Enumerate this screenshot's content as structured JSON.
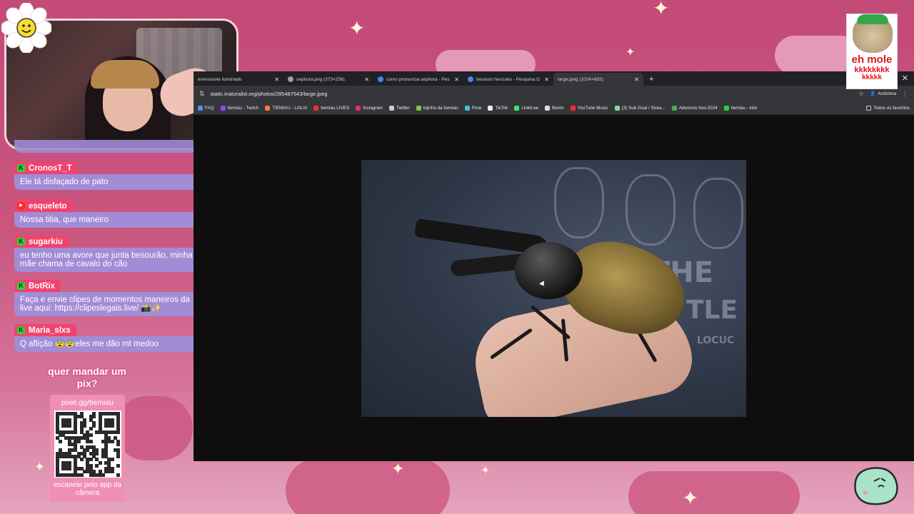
{
  "webcam": {
    "heart_colors": [
      "#ff3fa0",
      "#f7e05a",
      "#48d6c8"
    ]
  },
  "chat": {
    "messages": [
      {
        "platform": "kick",
        "user": "CronosT_T",
        "text": "Ele tá disfaçado de pato"
      },
      {
        "platform": "youtube",
        "user": "esqueleto",
        "text": "Nossa titia, que maneiro"
      },
      {
        "platform": "kick",
        "user": "sugarkiu",
        "text": "eu tenho uma avore que junta besourão, minha mãe chama de cavalo do cão"
      },
      {
        "platform": "kick",
        "user": "BotRix",
        "text": "Faça e envie clipes de momentos maneiros da live aqui: https://clipeslegais.live/ 📸✨"
      },
      {
        "platform": "kick",
        "user": "Maria_slxs",
        "text": "Q aflição 😨😨eles me dão mt medoo"
      }
    ],
    "colors": {
      "user_bg": "#f1426d",
      "bubble_bg": "#a38cd6"
    }
  },
  "pix": {
    "title": "quer mandar um pix?",
    "url": "pixie.gg/tiemiau",
    "scan_text": "escaneie pelo app da câmera"
  },
  "browser": {
    "tabs": [
      {
        "title": "ervescente iluminado",
        "active": false
      },
      {
        "title": "sephora.png (373×258)",
        "active": false
      },
      {
        "title": "como pronuncia sephora - Pes",
        "active": false
      },
      {
        "title": "besouro hercules - Pesquisa G",
        "active": false
      },
      {
        "title": "large.jpeg (1024×683)",
        "active": true
      }
    ],
    "new_tab": "+",
    "close_window": "✕",
    "address": "static.inaturalist.org/photos/285487543/large.jpeg",
    "profile": "Anônima",
    "bookmarks": [
      {
        "label": "FAQ",
        "color": "#4f8ff7"
      },
      {
        "label": "tiemiau - Twitch",
        "color": "#9146ff"
      },
      {
        "label": "TIEMIAU - LOLIA",
        "color": "#ff7a3d"
      },
      {
        "label": "tiemiau LIVES",
        "color": "#ff2a2a"
      },
      {
        "label": "Instagram",
        "color": "#e1306c"
      },
      {
        "label": "Twitter",
        "color": "#cccccc"
      },
      {
        "label": "lojinha da tiemiau",
        "color": "#88c057"
      },
      {
        "label": "Pixie",
        "color": "#3ec7c7"
      },
      {
        "label": "TikTok",
        "color": "#eeeeee"
      },
      {
        "label": "Linktr.ee",
        "color": "#43e660"
      },
      {
        "label": "Bento",
        "color": "#dddddd"
      },
      {
        "label": "YouTube Music",
        "color": "#ff2a2a"
      },
      {
        "label": "(3) Sub Goal / Strea...",
        "color": "#7be0a0"
      },
      {
        "label": "Adesivos Nov.2024",
        "color": "#4caf50"
      },
      {
        "label": "tiemiau - kick",
        "color": "#2fd13b"
      }
    ],
    "all_bookmarks": "Todos os favoritos",
    "photo": {
      "shirt_text_1": "THE",
      "shirt_text_2": "TLE",
      "shirt_text_3": "LOCUC"
    }
  },
  "meme": {
    "line1": "eh mole",
    "line2": "kkkkkkkk",
    "line3": "kkkkk"
  }
}
